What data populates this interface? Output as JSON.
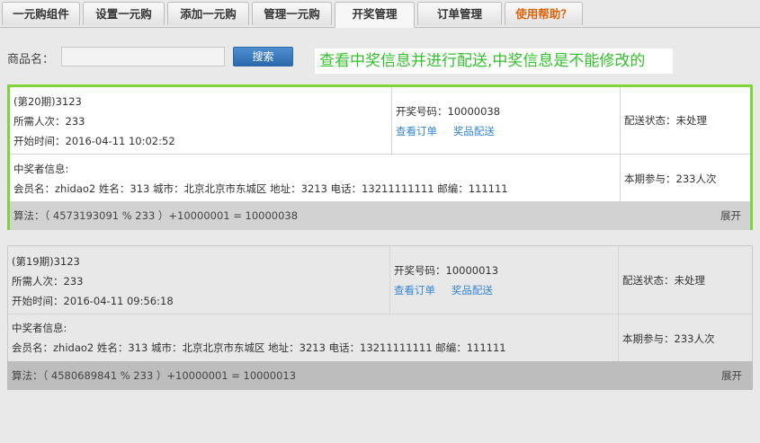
{
  "tabs": [
    {
      "label": "一元购组件"
    },
    {
      "label": "设置一元购"
    },
    {
      "label": "添加一元购"
    },
    {
      "label": "管理一元购"
    },
    {
      "label": "开奖管理"
    },
    {
      "label": "订单管理"
    },
    {
      "label": "使用帮助？"
    }
  ],
  "search": {
    "label": "商品名：",
    "value": "",
    "button": "搜索"
  },
  "notice": "查看中奖信息并进行配送,中奖信息是不能修改的",
  "records": [
    {
      "title": "(第20期)3123",
      "needed": "所需人次：233",
      "start": "开始时间：2016-04-11 10:02:52",
      "lottery_code": "开奖号码：10000038",
      "view_order": "查看订单",
      "deliver": "奖品配送",
      "delivery_status": "配送状态：未处理",
      "winner_heading": "中奖者信息:",
      "winner_info": "会员名：zhidao2 姓名：313  城市：北京北京市东城区  地址：3213  电话：13211111111  邮编：111111",
      "participation": "本期参与：233人次",
      "formula": "算法：（ 4573193091 % 233 ）+10000001 = 10000038",
      "expand": "展开"
    },
    {
      "title": "(第19期)3123",
      "needed": "所需人次：233",
      "start": "开始时间：2016-04-11 09:56:18",
      "lottery_code": "开奖号码：10000013",
      "view_order": "查看订单",
      "deliver": "奖品配送",
      "delivery_status": "配送状态：未处理",
      "winner_heading": "中奖者信息:",
      "winner_info": "会员名：zhidao2 姓名：313  城市：北京北京市东城区  地址：3213  电话：13211111111  邮编：111111",
      "participation": "本期参与：233人次",
      "formula": "算法：（ 4580689841 % 233 ）+10000001 = 10000013",
      "expand": "展开"
    }
  ],
  "colors": {
    "highlight_border": "#7fd43a",
    "link": "#3385d6",
    "notice_text": "#34c02d",
    "help_tab": "#e0600a"
  }
}
